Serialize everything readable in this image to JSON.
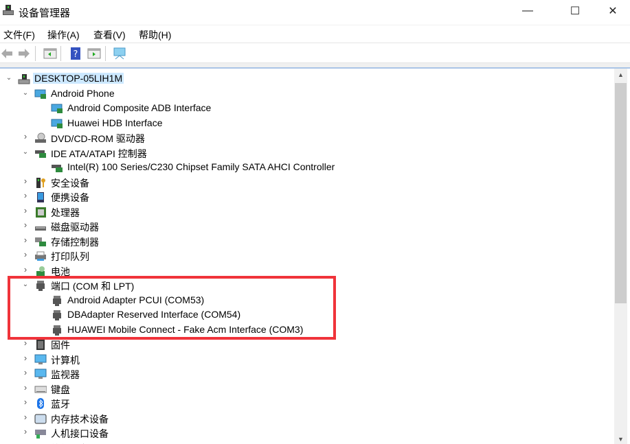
{
  "window": {
    "title": "设备管理器",
    "minimize": "—",
    "maximize": "☐",
    "close": "✕"
  },
  "menu": [
    "文件(F)",
    "操作(A)",
    "查看(V)",
    "帮助(H)"
  ],
  "toolbar": [
    "back-icon",
    "forward-icon",
    "show-hide-tree-icon",
    "help-icon",
    "properties-icon",
    "scan-hardware-icon"
  ],
  "tree": [
    {
      "label": "DESKTOP-05LIH1M",
      "level": 0,
      "state": "open",
      "icon": "computer",
      "selected": true
    },
    {
      "label": "Android Phone",
      "level": 1,
      "state": "open",
      "icon": "monitor-board"
    },
    {
      "label": "Android Composite ADB Interface",
      "level": 2,
      "state": "",
      "icon": "monitor-board"
    },
    {
      "label": "Huawei HDB Interface",
      "level": 2,
      "state": "",
      "icon": "monitor-board"
    },
    {
      "label": "DVD/CD-ROM 驱动器",
      "level": 1,
      "state": "closed",
      "icon": "dvd"
    },
    {
      "label": "IDE ATA/ATAPI 控制器",
      "level": 1,
      "state": "open",
      "icon": "controller"
    },
    {
      "label": "Intel(R) 100 Series/C230 Chipset Family SATA AHCI Controller",
      "level": 2,
      "state": "",
      "icon": "controller"
    },
    {
      "label": "安全设备",
      "level": 1,
      "state": "closed",
      "icon": "security"
    },
    {
      "label": "便携设备",
      "level": 1,
      "state": "closed",
      "icon": "portable"
    },
    {
      "label": "处理器",
      "level": 1,
      "state": "closed",
      "icon": "cpu"
    },
    {
      "label": "磁盘驱动器",
      "level": 1,
      "state": "closed",
      "icon": "disk"
    },
    {
      "label": "存储控制器",
      "level": 1,
      "state": "closed",
      "icon": "storage"
    },
    {
      "label": "打印队列",
      "level": 1,
      "state": "closed",
      "icon": "printer"
    },
    {
      "label": "电池",
      "level": 1,
      "state": "closed",
      "icon": "battery"
    },
    {
      "label": "端口 (COM 和 LPT)",
      "level": 1,
      "state": "open",
      "icon": "port"
    },
    {
      "label": "Android Adapter PCUI (COM53)",
      "level": 2,
      "state": "",
      "icon": "port"
    },
    {
      "label": "DBAdapter Reserved Interface (COM54)",
      "level": 2,
      "state": "",
      "icon": "port"
    },
    {
      "label": "HUAWEI Mobile Connect - Fake Acm Interface (COM3)",
      "level": 2,
      "state": "",
      "icon": "port"
    },
    {
      "label": "固件",
      "level": 1,
      "state": "closed",
      "icon": "firmware"
    },
    {
      "label": "计算机",
      "level": 1,
      "state": "closed",
      "icon": "monitor"
    },
    {
      "label": "监视器",
      "level": 1,
      "state": "closed",
      "icon": "monitor"
    },
    {
      "label": "键盘",
      "level": 1,
      "state": "closed",
      "icon": "keyboard"
    },
    {
      "label": "蓝牙",
      "level": 1,
      "state": "closed",
      "icon": "bluetooth"
    },
    {
      "label": "内存技术设备",
      "level": 1,
      "state": "closed",
      "icon": "memory"
    },
    {
      "label": "人机接口设备",
      "level": 1,
      "state": "closed",
      "icon": "hid"
    },
    {
      "label": "软件设备",
      "level": 1,
      "state": "closed",
      "icon": "software"
    }
  ],
  "highlight_color": "#f0333a"
}
